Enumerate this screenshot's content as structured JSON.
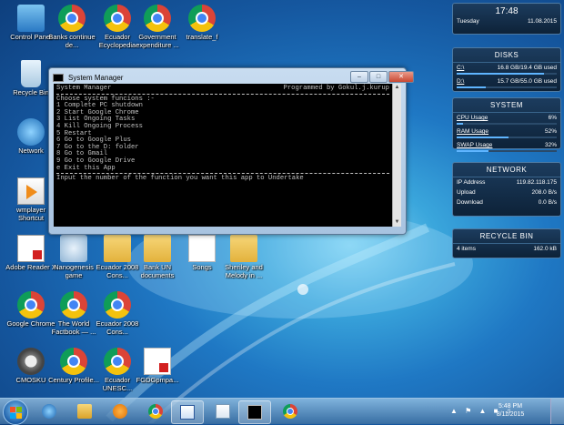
{
  "desktop_icons": [
    {
      "label": "Control Panel",
      "kind": "control"
    },
    {
      "label": "Banks continue de...",
      "kind": "chrome"
    },
    {
      "label": "Ecuador Ecyclopedia",
      "kind": "chrome"
    },
    {
      "label": "Government expenditure ...",
      "kind": "chrome"
    },
    {
      "label": "translate_f",
      "kind": "chrome"
    },
    {
      "label": "Recycle Bin",
      "kind": "recycle"
    },
    {
      "label": "Network",
      "kind": "network"
    },
    {
      "label": "wmplayer Shortcut",
      "kind": "media"
    },
    {
      "label": "Adobe Reader X",
      "kind": "adobe"
    },
    {
      "label": "Nanogenesis game",
      "kind": "magnifier"
    },
    {
      "label": "Ecuador 2008 Cons...",
      "kind": "folder"
    },
    {
      "label": "Bank UN documents",
      "kind": "folder"
    },
    {
      "label": "Songs",
      "kind": "doc"
    },
    {
      "label": "Sheriley and Melody in ...",
      "kind": "folder"
    },
    {
      "label": "Google Chrome",
      "kind": "chrome"
    },
    {
      "label": "The World Factbook — ...",
      "kind": "chrome"
    },
    {
      "label": "Ecuador 2008 Cons...",
      "kind": "chrome"
    },
    {
      "label": "CMOSKU",
      "kind": "gear"
    },
    {
      "label": "Century Profile...",
      "kind": "chrome"
    },
    {
      "label": "Ecuador UNESC...",
      "kind": "chrome"
    },
    {
      "label": "FGDGpmpa...",
      "kind": "pdf"
    }
  ],
  "gadgets": {
    "clock": {
      "time": "17:48",
      "day": "Tuesday",
      "date": "11.08.2015"
    },
    "disks": {
      "title": "DISKS",
      "items": [
        {
          "name": "C:\\",
          "value": "16.8 GB/19.4 GB used",
          "fraction": 0.87
        },
        {
          "name": "D:\\",
          "value": "15.7 GB/55.0 GB used",
          "fraction": 0.29
        }
      ]
    },
    "system": {
      "title": "SYSTEM",
      "items": [
        {
          "name": "CPU Usage",
          "value": "6%",
          "fraction": 0.06
        },
        {
          "name": "RAM Usage",
          "value": "52%",
          "fraction": 0.52
        },
        {
          "name": "SWAP Usage",
          "value": "32%",
          "fraction": 0.32
        }
      ]
    },
    "network": {
      "title": "NETWORK",
      "items": [
        {
          "name": "IP Address",
          "value": "119.82.118.175"
        },
        {
          "name": "Upload",
          "value": "208.0 B/s"
        },
        {
          "name": "Download",
          "value": "0.0 B/s"
        }
      ]
    },
    "recycle": {
      "title": "RECYCLE BIN",
      "items": [
        {
          "name": "4 items",
          "value": "162.0 kB"
        }
      ]
    }
  },
  "window": {
    "title": "System Manager",
    "header_left": "System Manager",
    "header_right": "Programmed by Gokul.j.kurup",
    "lines": [
      "Choose system funcions :-",
      "1 Complete PC shutdown",
      "2 Start Google Chrome",
      "3 List Ongoing Tasks",
      "4 Kill Ongoing Process",
      "5 Restart",
      "6 Go to Google Plus",
      "7 Go to the D: folder",
      "8 Go to Gmail",
      "9 Go to Google Drive",
      "e Exit this App"
    ],
    "prompt": "Input the number of the function you want this app to Undertake"
  },
  "taskbar": {
    "apps": [
      "Internet Explorer",
      "Windows Explorer",
      "Windows Media Player",
      "Google Chrome",
      "Word",
      "Notepad",
      "Command Prompt",
      "Google Chrome"
    ],
    "clock_time": "5:48 PM",
    "clock_date": "8/11/2015"
  }
}
